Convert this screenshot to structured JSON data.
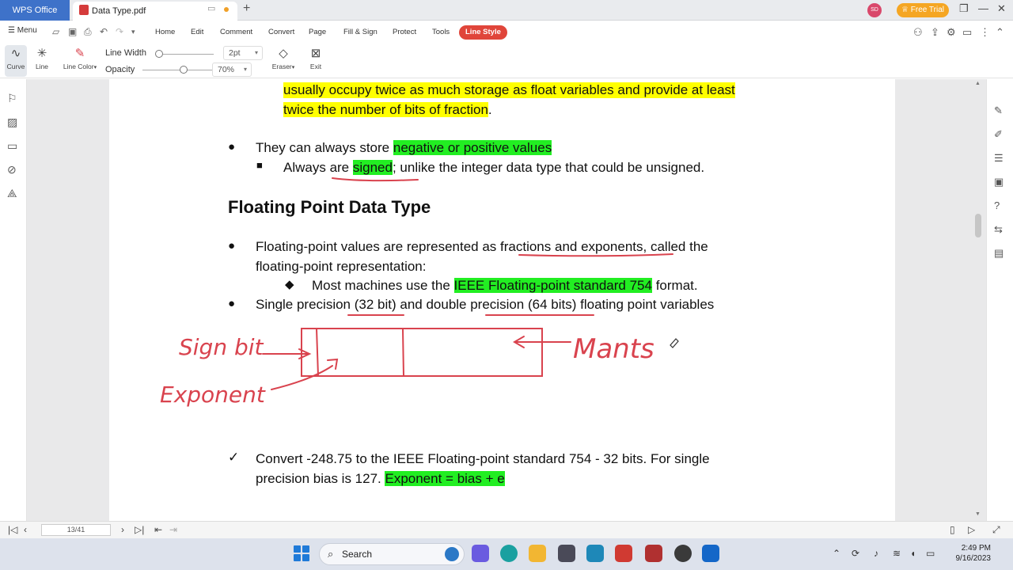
{
  "titlebar": {
    "app_tab": "WPS Office",
    "doc_tab": "Data Type.pdf",
    "new_tab": "+",
    "avatar_initials": "SD",
    "trial": "Free Trial"
  },
  "menubar": {
    "menu_label": "Menu",
    "items": [
      "Home",
      "Edit",
      "Comment",
      "Convert",
      "Page",
      "Fill & Sign",
      "Protect",
      "Tools"
    ],
    "active": "Line Style"
  },
  "toolbar": {
    "curve": "Curve",
    "line": "Line",
    "line_color": "Line Color",
    "line_width_label": "Line Width",
    "line_width_value": "2pt",
    "opacity_label": "Opacity",
    "opacity_value": "70%",
    "eraser": "Eraser",
    "exit": "Exit"
  },
  "document": {
    "para1_line1": "usually occupy twice as much storage as float variables and provide at least",
    "para1_line2": "twice the number of bits of fraction",
    "para1_end": ".",
    "b1_pre": "They can always store ",
    "b1_hl": "negative or positive values",
    "b1_sub_pre": "Always are ",
    "b1_sub_hl": "signed",
    "b1_sub_post": "; unlike the integer data type that could be unsigned.",
    "heading": "Floating Point Data Type",
    "b2_line1": "Floating-point values are represented as fractions and exponents, called the",
    "b2_line2": "floating-point representation:",
    "b2_sub_pre": "Most machines use the ",
    "b2_sub_hl": "IEEE Floating-point standard 754",
    "b2_sub_post": " format.",
    "b3": "Single precision (32 bit) and double precision (64 bits) floating point variables",
    "check_line1": "Convert -248.75 to the IEEE Floating-point standard 754 - 32 bits. For single",
    "check_line2_pre": "precision bias is 127. ",
    "check_line2_hl": "Exponent = bias + e"
  },
  "ink": {
    "sign_bit": "Sign bit",
    "exponent": "Exponent",
    "mantissa": "Mants",
    "color": "#d9434e"
  },
  "statusbar": {
    "page": "13/41"
  },
  "taskbar": {
    "search": "Search",
    "time": "2:49 PM",
    "date": "9/16/2023"
  },
  "colors": {
    "accent": "#e0453a",
    "wps_blue": "#3e72c9",
    "highlight_yellow": "#ffff00",
    "highlight_green": "#22ee22"
  }
}
